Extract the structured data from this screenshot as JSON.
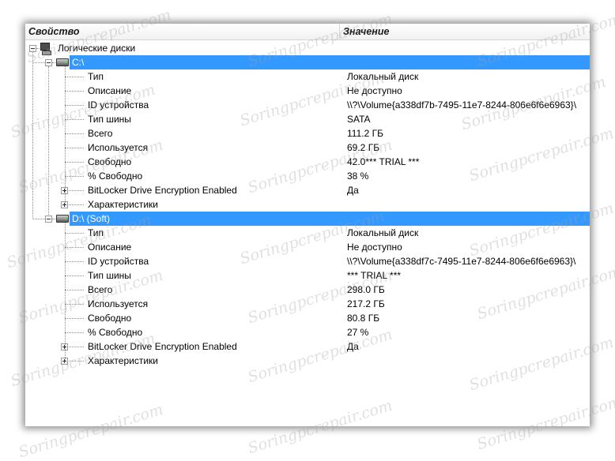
{
  "header": {
    "property": "Свойство",
    "value": "Значение"
  },
  "root": {
    "label": "Логические диски"
  },
  "drives": [
    {
      "label": "C:\\",
      "props": [
        {
          "name": "Тип",
          "value": "Локальный диск"
        },
        {
          "name": "Описание",
          "value": "Не доступно"
        },
        {
          "name": "ID устройства",
          "value": "\\\\?\\Volume{a338df7b-7495-11e7-8244-806e6f6e6963}\\"
        },
        {
          "name": "Тип шины",
          "value": "SATA"
        },
        {
          "name": "Всего",
          "value": "111.2 ГБ"
        },
        {
          "name": "Используется",
          "value": "69.2 ГБ"
        },
        {
          "name": "Свободно",
          "value": "42.0*** TRIAL ***"
        },
        {
          "name": "% Свободно",
          "value": "38 %"
        },
        {
          "name": "BitLocker Drive Encryption Enabled",
          "value": "Да"
        },
        {
          "name": "Характеристики",
          "value": ""
        }
      ]
    },
    {
      "label": "D:\\   (Soft)",
      "props": [
        {
          "name": "Тип",
          "value": "Локальный диск"
        },
        {
          "name": "Описание",
          "value": "Не доступно"
        },
        {
          "name": "ID устройства",
          "value": "\\\\?\\Volume{a338df7c-7495-11e7-8244-806e6f6e6963}\\"
        },
        {
          "name": "Тип шины",
          "value": "*** TRIAL ***"
        },
        {
          "name": "Всего",
          "value": "298.0 ГБ"
        },
        {
          "name": "Используется",
          "value": "217.2 ГБ"
        },
        {
          "name": "Свободно",
          "value": "80.8 ГБ"
        },
        {
          "name": "% Свободно",
          "value": "27 %"
        },
        {
          "name": "BitLocker Drive Encryption Enabled",
          "value": "Да"
        },
        {
          "name": "Характеристики",
          "value": ""
        }
      ]
    }
  ],
  "watermark": "Soringpcrepair.com",
  "colors": {
    "selection": "#3399ff"
  }
}
